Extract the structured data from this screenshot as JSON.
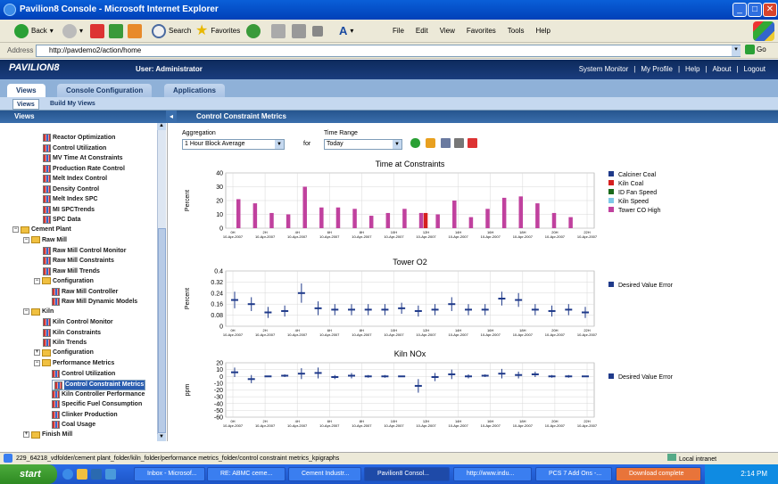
{
  "window": {
    "title": "Pavilion8 Console - Microsoft Internet Explorer"
  },
  "toolbar": {
    "back": "Back",
    "search": "Search",
    "favorites": "Favorites",
    "menu": [
      "File",
      "Edit",
      "View",
      "Favorites",
      "Tools",
      "Help"
    ]
  },
  "address": {
    "label": "Address",
    "url": "http://pavdemo2/action/home",
    "go": "Go"
  },
  "app": {
    "logo": "PAVILION8",
    "user": "User: Administrator",
    "links": [
      "System Monitor",
      "My Profile",
      "Help",
      "About",
      "Logout"
    ]
  },
  "tabs": [
    "Views",
    "Console Configuration",
    "Applications"
  ],
  "subtabs": [
    "Views",
    "Build My Views"
  ],
  "sidebar": {
    "header": "Views",
    "items": [
      "Reactor Optimization",
      "Control Utilization",
      "MV Time At Constraints",
      "Production Rate Control",
      "Melt Index Control",
      "Density Control",
      "Melt Index SPC",
      "MI SPCTrends",
      "SPC Data",
      "Cement Plant",
      "Raw Mill",
      "Raw Mill Control Monitor",
      "Raw Mill Constraints",
      "Raw Mill Trends",
      "Configuration",
      "Raw Mill Controller",
      "Raw Mill Dynamic Models",
      "Kiln",
      "Kiln Control Monitor",
      "Kiln Constraints",
      "Kiln Trends",
      "Configuration",
      "Performance Metrics",
      "Control Utilization",
      "Control Constraint Metrics",
      "Kiln Controller Performance",
      "Specific Fuel Consumption",
      "Clinker Production",
      "Coal Usage",
      "Finish Mill"
    ]
  },
  "main": {
    "header": "Control Constraint Metrics",
    "aggregation_label": "Aggregation",
    "aggregation_value": "1 Hour Block Average",
    "for_label": "for",
    "time_range_label": "Time Range",
    "time_range_value": "Today"
  },
  "xticks": [
    "0H",
    "2H",
    "4H",
    "6H",
    "8H",
    "10H",
    "12H",
    "14H",
    "16H",
    "18H",
    "20H",
    "22H"
  ],
  "xdate": "10-Apr-2007",
  "chart_data": [
    {
      "type": "bar",
      "title": "Time at Constraints",
      "ylabel": "Percent",
      "ylim": [
        0,
        40
      ],
      "yticks": [
        0,
        10,
        20,
        30,
        40
      ],
      "legend": [
        {
          "name": "Calciner Coal",
          "color": "#1f3a8a"
        },
        {
          "name": "Kiln Coal",
          "color": "#d62020"
        },
        {
          "name": "ID Fan Speed",
          "color": "#1a6a1a"
        },
        {
          "name": "Kiln Speed",
          "color": "#7ec8e8"
        },
        {
          "name": "Tower CO High",
          "color": "#c0419e"
        }
      ],
      "series": [
        {
          "name": "Tower CO High",
          "color": "#c0419e",
          "values": [
            21,
            18,
            11,
            10,
            30,
            15,
            15,
            14,
            9,
            11,
            14,
            11,
            10,
            20,
            8,
            14,
            22,
            23,
            18,
            11,
            8
          ]
        },
        {
          "name": "Kiln Coal",
          "color": "#d62020",
          "values": [
            0,
            0,
            0,
            0,
            0,
            0,
            0,
            0,
            0,
            0,
            0,
            11,
            0,
            0,
            0,
            0,
            0,
            0,
            0,
            0,
            0
          ]
        }
      ]
    },
    {
      "type": "scatter",
      "title": "Tower O2",
      "ylabel": "Percent",
      "ylim": [
        0,
        0.4
      ],
      "yticks": [
        "0",
        "0.08",
        "0.16",
        "0.24",
        "0.32",
        "0.4"
      ],
      "legend": [
        {
          "name": "Desired Value Error",
          "color": "#1f3a8a"
        }
      ],
      "series": [
        {
          "name": "Desired Value Error",
          "mean": [
            0.19,
            0.16,
            0.1,
            0.11,
            0.24,
            0.13,
            0.12,
            0.12,
            0.12,
            0.12,
            0.13,
            0.11,
            0.12,
            0.16,
            0.12,
            0.12,
            0.2,
            0.19,
            0.12,
            0.11,
            0.12,
            0.1
          ],
          "err": [
            0.06,
            0.05,
            0.04,
            0.04,
            0.07,
            0.05,
            0.04,
            0.04,
            0.04,
            0.04,
            0.04,
            0.04,
            0.04,
            0.05,
            0.04,
            0.04,
            0.05,
            0.05,
            0.04,
            0.04,
            0.04,
            0.04
          ]
        }
      ]
    },
    {
      "type": "scatter",
      "title": "Kiln NOx",
      "ylabel": "ppm",
      "ylim": [
        -60,
        20
      ],
      "yticks": [
        "20",
        "10",
        "0",
        "-10",
        "-20",
        "-30",
        "-40",
        "-50",
        "-60"
      ],
      "legend": [
        {
          "name": "Desired Value Error",
          "color": "#1f3a8a"
        }
      ],
      "series": [
        {
          "name": "Desired Value Error",
          "mean": [
            6,
            -4,
            0,
            1,
            4,
            5,
            -1,
            1,
            0,
            0,
            0,
            -14,
            -1,
            3,
            0,
            1,
            4,
            2,
            3,
            0,
            0,
            0
          ],
          "err": [
            7,
            6,
            1,
            2,
            8,
            8,
            3,
            4,
            2,
            2,
            1,
            10,
            6,
            7,
            3,
            2,
            7,
            5,
            4,
            2,
            2,
            1
          ]
        }
      ]
    }
  ],
  "status": {
    "path": "229_64218_vdfolder/cement plant_folder/kiln_folder/performance metrics_folder/control constraint metrics_kpigraphs",
    "zone": "Local intranet"
  },
  "taskbar": {
    "start": "start",
    "tasks": [
      "Inbox - Microsof...",
      "RE: ABMC ceme...",
      "Cement Industr...",
      "Pavilion8 Consol...",
      "http://www.indu...",
      "PCS 7 Add Ons -...",
      "Download complete"
    ],
    "clock": "2:14 PM"
  }
}
